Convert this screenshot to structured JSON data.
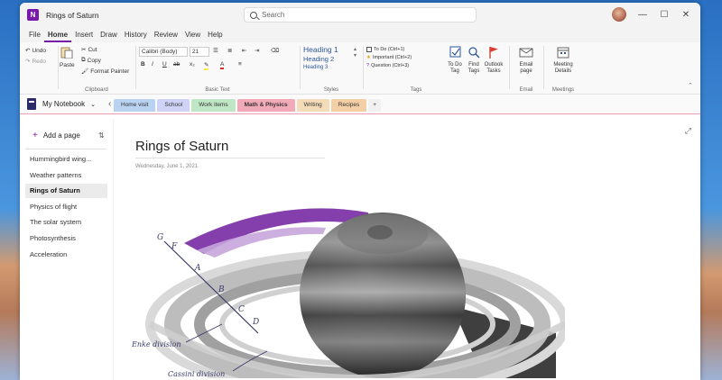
{
  "window": {
    "title": "Rings of Saturn",
    "app_icon_letter": "N"
  },
  "search": {
    "placeholder": "Search"
  },
  "menu": [
    "File",
    "Home",
    "Insert",
    "Draw",
    "History",
    "Review",
    "View",
    "Help"
  ],
  "ribbon": {
    "undo": "Undo",
    "redo": "Redo",
    "paste": "Paste",
    "cut": "Cut",
    "copy": "Copy",
    "format_painter": "Format Painter",
    "clipboard_label": "Clipboard",
    "font_name": "Calibri (Body)",
    "font_size": "21",
    "basic_text_label": "Basic Text",
    "heading1": "Heading 1",
    "heading2": "Heading 2",
    "heading3": "Heading 3",
    "styles_label": "Styles",
    "tag1": "To Do (Ctrl+1)",
    "tag2": "Important (Ctrl+2)",
    "tag3": "Question (Ctrl+3)",
    "tags_label": "Tags",
    "todo_tag": "To Do Tag",
    "find_tags": "Find Tags",
    "outlook_tasks": "Outlook Tasks",
    "email_page": "Email page",
    "email_label": "Email",
    "meeting_details": "Meeting Details",
    "meetings_label": "Meetings",
    "bold": "B",
    "italic": "I",
    "underline": "U"
  },
  "notebook": {
    "name": "My Notebook"
  },
  "tabs": [
    {
      "label": "Home visit",
      "color": "#b9d3f0"
    },
    {
      "label": "School",
      "color": "#cfd3f6"
    },
    {
      "label": "Work items",
      "color": "#bfe6c5"
    },
    {
      "label": "Math & Physics",
      "color": "#f3aab8"
    },
    {
      "label": "Writing",
      "color": "#f3dcb8"
    },
    {
      "label": "Recipes",
      "color": "#f4cfa6"
    },
    {
      "label": "+",
      "color": "#f1f1f1"
    }
  ],
  "sidebar": {
    "add_page": "Add a page",
    "pages": [
      "Hummingbird wing...",
      "Weather patterns",
      "Rings of Saturn",
      "Physics of flight",
      "The solar system",
      "Photosynthesis",
      "Acceleration"
    ],
    "selected": 2
  },
  "page": {
    "title": "Rings of Saturn",
    "date": "Wednesday, June 1, 2021",
    "ring_labels": [
      "G",
      "F",
      "A",
      "B",
      "C",
      "D"
    ],
    "annotations": [
      "Enke division",
      "Cassini division"
    ]
  },
  "colors": {
    "accent": "#7719aa",
    "ring_purple": "#7b2fa5"
  }
}
